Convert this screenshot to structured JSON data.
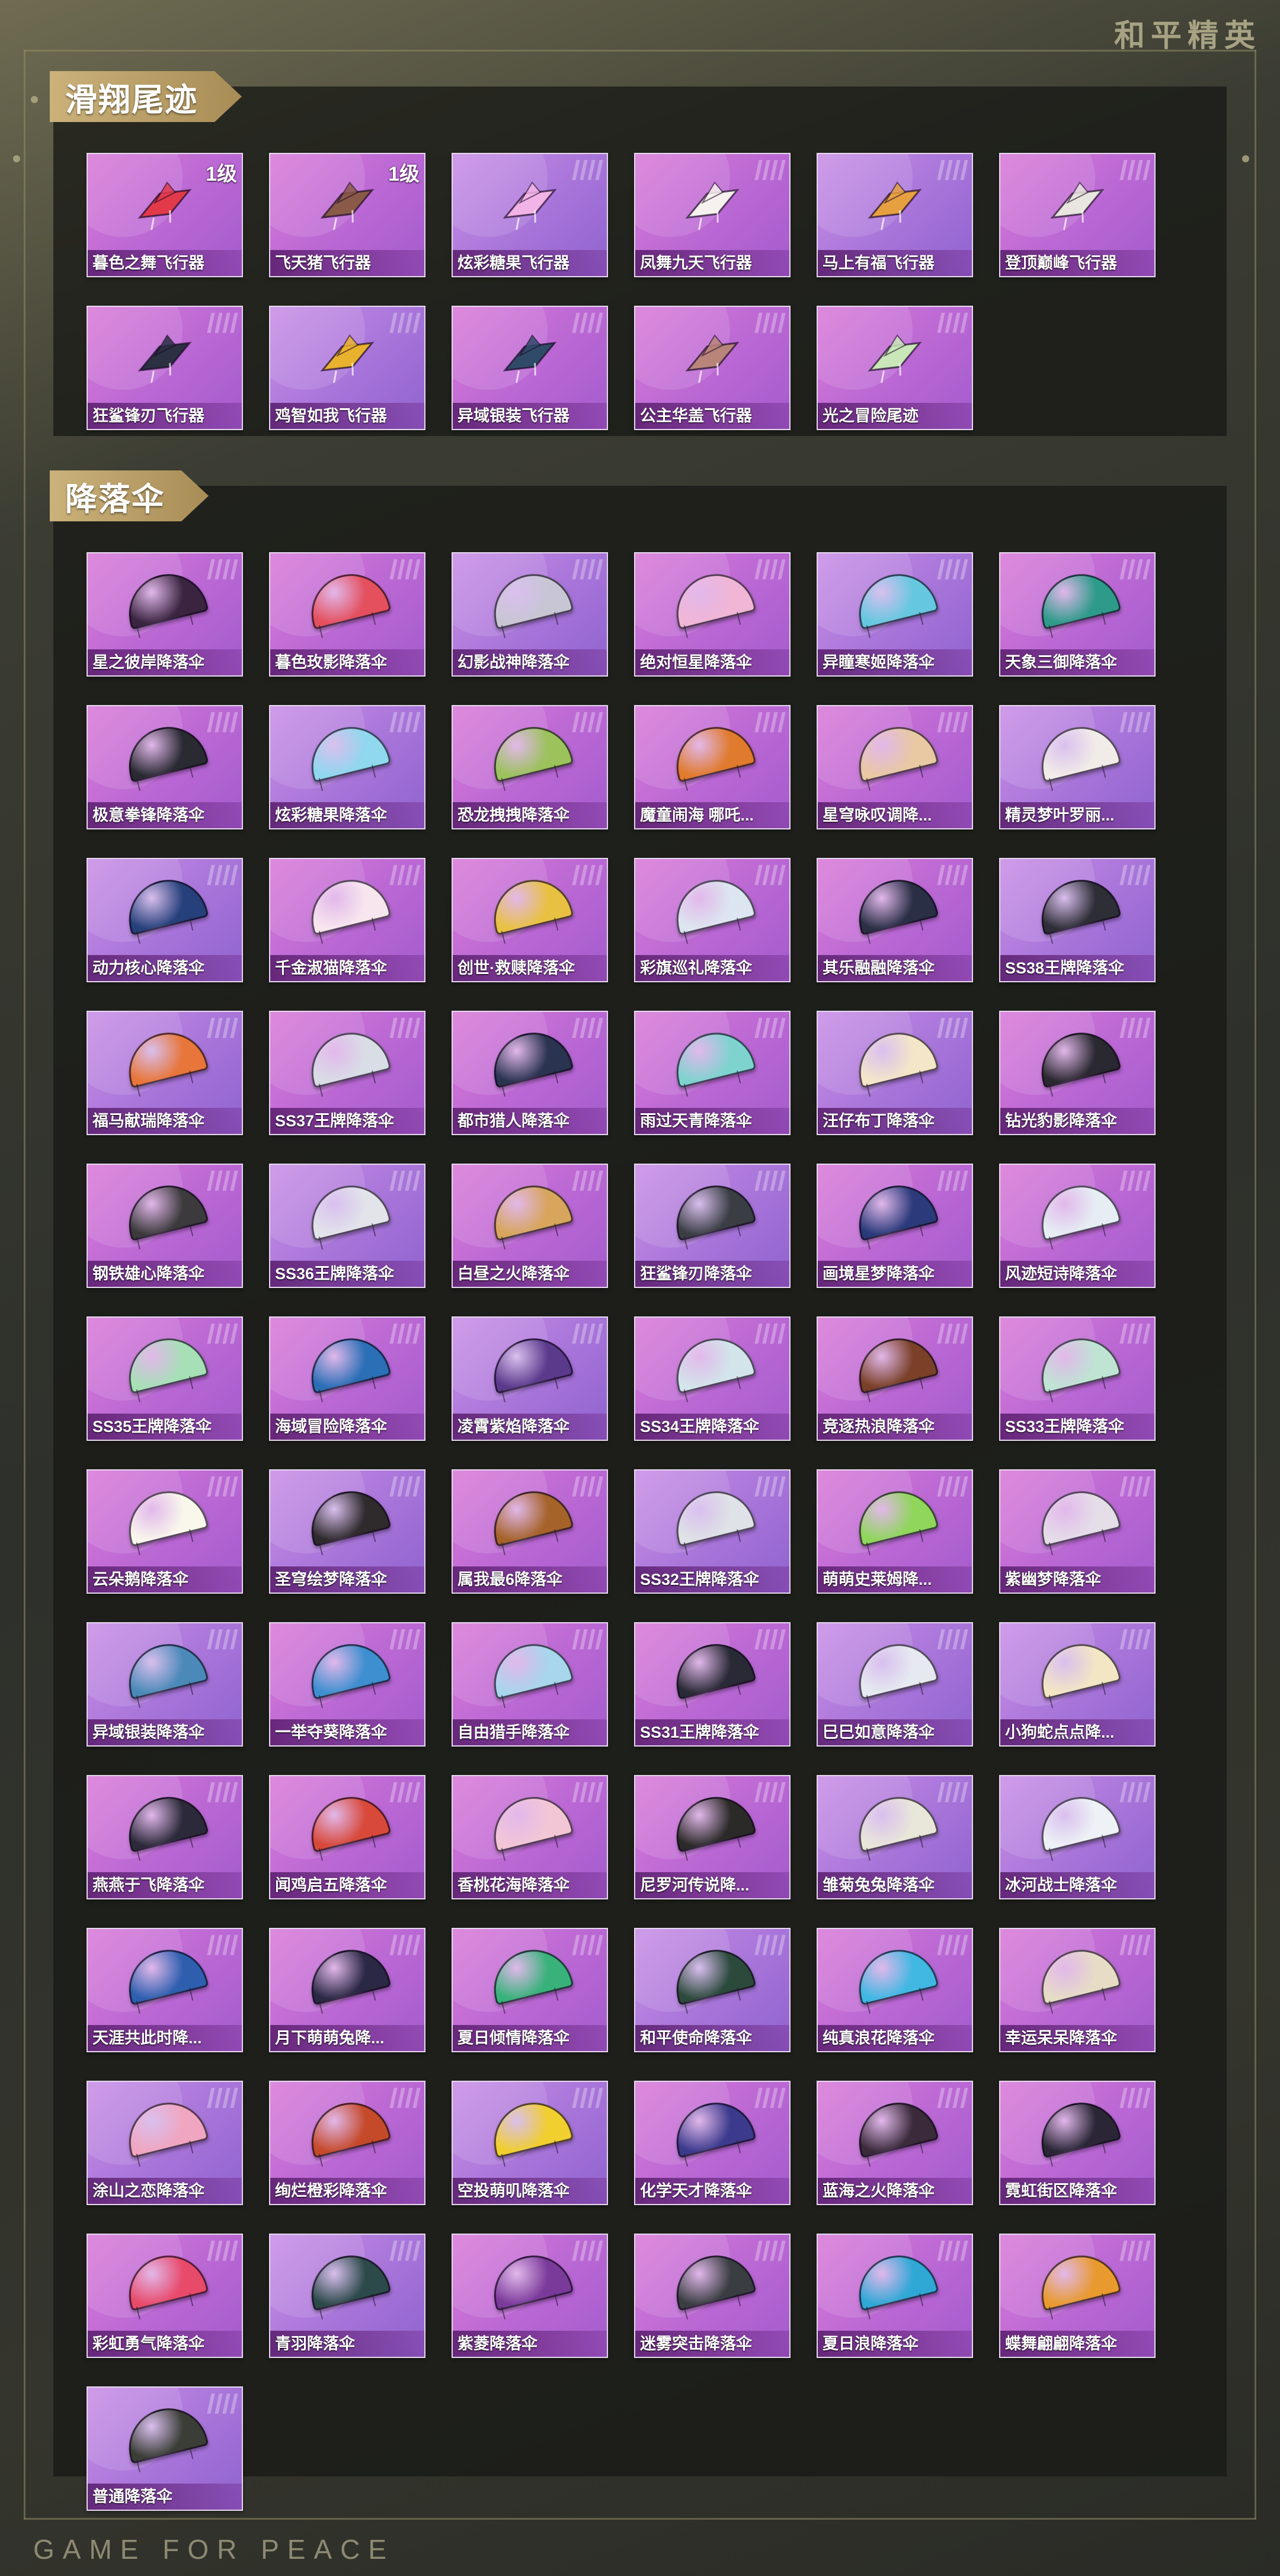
{
  "brand": {
    "cn": "和平精英",
    "en": "GAME FOR PEACE"
  },
  "sections": {
    "gliders": {
      "title": "滑翔尾迹",
      "items": [
        {
          "name": "暮色之舞飞行器",
          "badge": "1级",
          "color": "#e23a4a"
        },
        {
          "name": "飞天猪飞行器",
          "badge": "1级",
          "color": "#8a5a48"
        },
        {
          "name": "炫彩糖果飞行器",
          "badge": "",
          "color": "#f2b3e6"
        },
        {
          "name": "凤舞九天飞行器",
          "badge": "",
          "color": "#f6f1ee"
        },
        {
          "name": "马上有福飞行器",
          "badge": "",
          "color": "#e7a040"
        },
        {
          "name": "登顶巅峰飞行器",
          "badge": "",
          "color": "#e8e6df"
        },
        {
          "name": "狂鲨锋刃飞行器",
          "badge": "",
          "color": "#2b3042"
        },
        {
          "name": "鸡智如我飞行器",
          "badge": "",
          "color": "#e9b22e"
        },
        {
          "name": "异域银装飞行器",
          "badge": "",
          "color": "#2f4b69"
        },
        {
          "name": "公主华盖飞行器",
          "badge": "",
          "color": "#b9857b"
        },
        {
          "name": "光之冒险尾迹",
          "badge": "",
          "color": "#c9e7b9"
        }
      ]
    },
    "parachutes": {
      "title": "降落伞",
      "items": [
        {
          "name": "星之彼岸降落伞",
          "color": "#3a2440"
        },
        {
          "name": "暮色玫影降落伞",
          "color": "#e4505e"
        },
        {
          "name": "幻影战神降落伞",
          "color": "#c8c6d4"
        },
        {
          "name": "绝对恒星降落伞",
          "color": "#f1b6d6"
        },
        {
          "name": "异瞳寒姬降落伞",
          "color": "#66c8e0"
        },
        {
          "name": "天象三御降落伞",
          "color": "#2e9b8a"
        },
        {
          "name": "极意拳锋降落伞",
          "color": "#2a2a32"
        },
        {
          "name": "炫彩糖果降落伞",
          "color": "#8fd8ee"
        },
        {
          "name": "恐龙拽拽降落伞",
          "color": "#9bc25b"
        },
        {
          "name": "魔童闹海 哪吒...",
          "color": "#e07a2c"
        },
        {
          "name": "星穹咏叹调降...",
          "color": "#e9c8a4"
        },
        {
          "name": "精灵梦叶罗丽...",
          "color": "#f2ece8"
        },
        {
          "name": "动力核心降落伞",
          "color": "#25407a"
        },
        {
          "name": "千金淑猫降落伞",
          "color": "#f8e6ee"
        },
        {
          "name": "创世·救赎降落伞",
          "color": "#e9c142"
        },
        {
          "name": "彩旗巡礼降落伞",
          "color": "#dde6f0"
        },
        {
          "name": "其乐融融降落伞",
          "color": "#2a2f45"
        },
        {
          "name": "SS38王牌降落伞",
          "color": "#2e2e36"
        },
        {
          "name": "福马献瑞降落伞",
          "color": "#e8763a"
        },
        {
          "name": "SS37王牌降落伞",
          "color": "#d9dde6"
        },
        {
          "name": "都市猎人降落伞",
          "color": "#2a3350"
        },
        {
          "name": "雨过天青降落伞",
          "color": "#7fd3cf"
        },
        {
          "name": "汪仔布丁降落伞",
          "color": "#f4e6c8"
        },
        {
          "name": "钻光豹影降落伞",
          "color": "#2a2830"
        },
        {
          "name": "钢铁雄心降落伞",
          "color": "#3c3a3c"
        },
        {
          "name": "SS36王牌降落伞",
          "color": "#e2e4ea"
        },
        {
          "name": "白昼之火降落伞",
          "color": "#d7a55c"
        },
        {
          "name": "狂鲨锋刃降落伞",
          "color": "#3a3e44"
        },
        {
          "name": "画境星梦降落伞",
          "color": "#2a3a7a"
        },
        {
          "name": "风迹短诗降落伞",
          "color": "#e6eef4"
        },
        {
          "name": "SS35王牌降落伞",
          "color": "#a7e0b6"
        },
        {
          "name": "海域冒险降落伞",
          "color": "#2b6fb6"
        },
        {
          "name": "凌霄紫焰降落伞",
          "color": "#5b3a8c"
        },
        {
          "name": "SS34王牌降落伞",
          "color": "#d3e4ea"
        },
        {
          "name": "竞逐热浪降落伞",
          "color": "#7a4028"
        },
        {
          "name": "SS33王牌降落伞",
          "color": "#bfe4d3"
        },
        {
          "name": "云朵鹅降落伞",
          "color": "#f9f6ec"
        },
        {
          "name": "圣穹绘梦降落伞",
          "color": "#2f2a2c"
        },
        {
          "name": "属我最6降落伞",
          "color": "#a5632a"
        },
        {
          "name": "SS32王牌降落伞",
          "color": "#dfe2e6"
        },
        {
          "name": "萌萌史莱姆降...",
          "color": "#8fd65b"
        },
        {
          "name": "紫幽梦降落伞",
          "color": "#e5dde8"
        },
        {
          "name": "异域银装降落伞",
          "color": "#4b8ab8"
        },
        {
          "name": "一举夺葵降落伞",
          "color": "#3e8fcf"
        },
        {
          "name": "自由猎手降落伞",
          "color": "#a8d6ec"
        },
        {
          "name": "SS31王牌降落伞",
          "color": "#2a2a36"
        },
        {
          "name": "巳巳如意降落伞",
          "color": "#e6eaf0"
        },
        {
          "name": "小狗蛇点点降...",
          "color": "#f3e6c4"
        },
        {
          "name": "燕燕于飞降落伞",
          "color": "#2c2a3a"
        },
        {
          "name": "闻鸡启五降落伞",
          "color": "#d8493a"
        },
        {
          "name": "香桃花海降落伞",
          "color": "#f3c6d6"
        },
        {
          "name": "尼罗河传说降...",
          "color": "#2b2a28"
        },
        {
          "name": "雏菊兔兔降落伞",
          "color": "#e9e6da"
        },
        {
          "name": "冰河战士降落伞",
          "color": "#eef2f6"
        },
        {
          "name": "天涯共此时降...",
          "color": "#2d5fae"
        },
        {
          "name": "月下萌萌兔降...",
          "color": "#2a2844"
        },
        {
          "name": "夏日倾情降落伞",
          "color": "#38b27a"
        },
        {
          "name": "和平使命降落伞",
          "color": "#2c4a3c"
        },
        {
          "name": "纯真浪花降落伞",
          "color": "#40b8e2"
        },
        {
          "name": "幸运呆呆降落伞",
          "color": "#e7dcc6"
        },
        {
          "name": "涂山之恋降落伞",
          "color": "#f0a6c0"
        },
        {
          "name": "绚烂橙彩降落伞",
          "color": "#c54a2a"
        },
        {
          "name": "空投萌叽降落伞",
          "color": "#f1cf2e"
        },
        {
          "name": "化学天才降落伞",
          "color": "#3b3a8c"
        },
        {
          "name": "蓝海之火降落伞",
          "color": "#3a2a3a"
        },
        {
          "name": "霓虹街区降落伞",
          "color": "#2a2636"
        },
        {
          "name": "彩虹勇气降落伞",
          "color": "#e84a6a"
        },
        {
          "name": "青羽降落伞",
          "color": "#2c4a4a"
        },
        {
          "name": "紫菱降落伞",
          "color": "#7a3a9a"
        },
        {
          "name": "迷雾突击降落伞",
          "color": "#3a3e42"
        },
        {
          "name": "夏日浪降落伞",
          "color": "#2fa8d6"
        },
        {
          "name": "蝶舞翩翩降落伞",
          "color": "#e89a2e"
        },
        {
          "name": "普通降落伞",
          "color": "#3a3e36"
        }
      ]
    }
  }
}
